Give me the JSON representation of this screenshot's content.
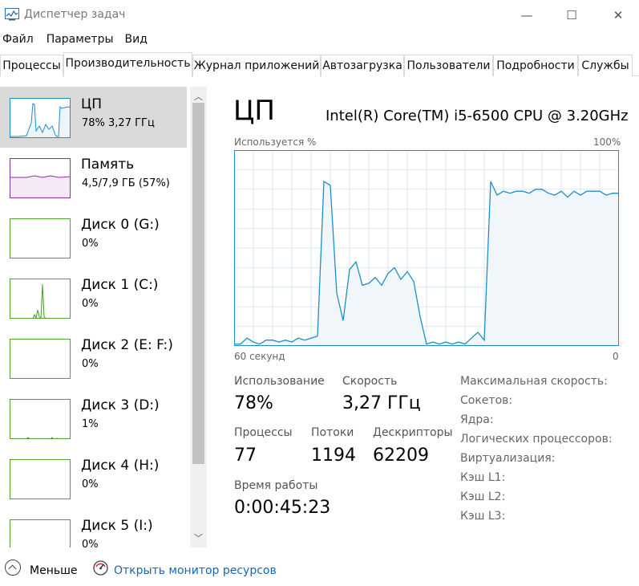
{
  "window": {
    "title": "Диспетчер задач",
    "minimize_glyph": "—",
    "maximize_glyph": "☐",
    "close_glyph": "✕"
  },
  "menu": [
    "Файл",
    "Параметры",
    "Вид"
  ],
  "tabs": [
    {
      "label": "Процессы",
      "active": false
    },
    {
      "label": "Производительность",
      "active": true
    },
    {
      "label": "Журнал приложений",
      "active": false
    },
    {
      "label": "Автозагрузка",
      "active": false
    },
    {
      "label": "Пользователи",
      "active": false
    },
    {
      "label": "Подробности",
      "active": false
    },
    {
      "label": "Службы",
      "active": false
    }
  ],
  "resources": [
    {
      "name": "ЦП",
      "sub": "78% 3,27 ГГц",
      "selected": true,
      "color": "#1d8fc7"
    },
    {
      "name": "Память",
      "sub": "4,5/7,9 ГБ (57%)",
      "selected": false,
      "color": "#8b2ea3"
    },
    {
      "name": "Диск 0 (G:)",
      "sub": "0%",
      "selected": false,
      "color": "#4da02c"
    },
    {
      "name": "Диск 1 (C:)",
      "sub": "0%",
      "selected": false,
      "color": "#4da02c"
    },
    {
      "name": "Диск 2 (E: F:)",
      "sub": "0%",
      "selected": false,
      "color": "#4da02c"
    },
    {
      "name": "Диск 3 (D:)",
      "sub": "1%",
      "selected": false,
      "color": "#4da02c"
    },
    {
      "name": "Диск 4 (H:)",
      "sub": "0%",
      "selected": false,
      "color": "#4da02c"
    },
    {
      "name": "Диск 5 (I:)",
      "sub": "0%",
      "selected": false,
      "color": "#4da02c"
    }
  ],
  "cpu": {
    "title": "ЦП",
    "model": "Intel(R) Core(TM) i5-6500 CPU @ 3.20GHz",
    "graph_label": "Используется %",
    "graph_max": "100%",
    "time_left": "60 секунд",
    "time_right": "0",
    "usage_label": "Использование",
    "usage_value": "78%",
    "speed_label": "Скорость",
    "speed_value": "3,27 ГГц",
    "processes_label": "Процессы",
    "processes_value": "77",
    "threads_label": "Потоки",
    "threads_value": "1194",
    "handles_label": "Дескрипторы",
    "handles_value": "62209",
    "uptime_label": "Время работы",
    "uptime_value": "0:00:45:23",
    "specs": [
      "Максимальная скорость:",
      "Сокетов:",
      "Ядра:",
      "Логических процессоров:",
      "Виртуализация:",
      "Кэш L1:",
      "Кэш L2:",
      "Кэш L3:"
    ]
  },
  "footer": {
    "less_label": "Меньше",
    "resmon_label": "Открыть монитор ресурсов"
  },
  "colors": {
    "cpu_line": "#1d8fc7",
    "cpu_fill": "#f1f6fa",
    "grid": "#d9eaf4",
    "memory": "#8b2ea3",
    "disk": "#4da02c"
  },
  "chart_data": {
    "type": "area",
    "ylim": [
      0,
      100
    ],
    "xlim": [
      60,
      0
    ],
    "x": [
      60,
      59,
      58,
      57,
      56,
      55,
      54,
      53,
      52,
      51,
      50,
      49,
      48,
      47,
      46,
      45,
      44,
      43,
      42,
      41,
      40,
      39,
      38,
      37,
      36,
      35,
      34,
      33,
      32,
      31,
      30,
      29,
      28,
      27,
      26,
      25,
      24,
      23,
      22,
      21,
      20,
      19,
      18,
      17,
      16,
      15,
      14,
      13,
      12,
      11,
      10,
      9,
      8,
      7,
      6,
      5,
      4,
      3,
      2,
      1,
      0
    ],
    "values": [
      1,
      1,
      4,
      2,
      1,
      3,
      3,
      2,
      3,
      2,
      4,
      3,
      4,
      5,
      84,
      82,
      27,
      13,
      39,
      43,
      31,
      32,
      35,
      31,
      37,
      40,
      34,
      38,
      33,
      15,
      1,
      2,
      1,
      2,
      1,
      2,
      1,
      4,
      7,
      3,
      84,
      77,
      79,
      78,
      79,
      79,
      78,
      80,
      80,
      78,
      77,
      79,
      76,
      79,
      77,
      79,
      79,
      79,
      77,
      78,
      78
    ]
  }
}
